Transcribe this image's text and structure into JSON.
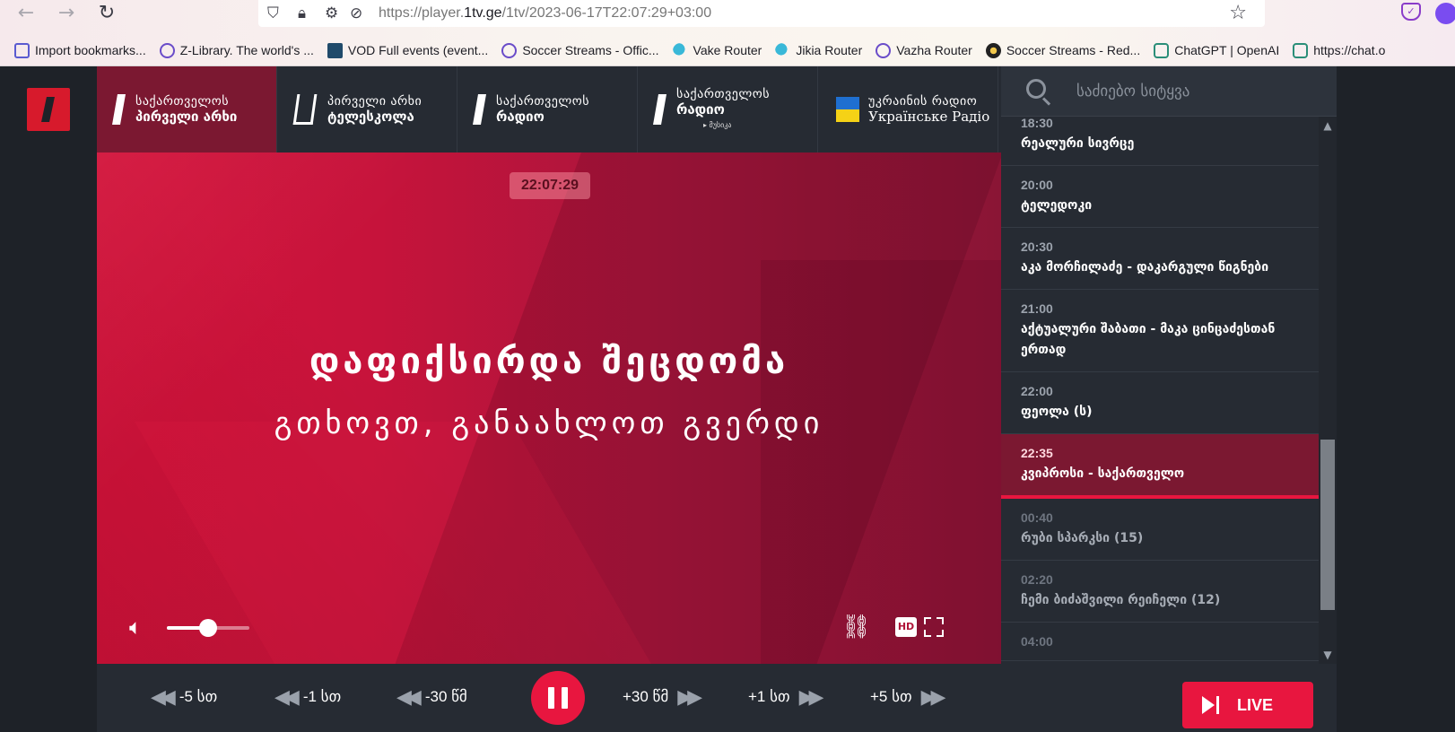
{
  "browser": {
    "back_icon": "←",
    "forward_icon": "→",
    "reload_icon": "↻",
    "url_prefix": "https://player.",
    "url_host": "1tv.ge",
    "url_path": "/1tv/2023-06-17T22:07:29+03:00",
    "bookmarks": [
      {
        "label": "Import bookmarks...",
        "icon": "import-icon"
      },
      {
        "label": "Z-Library. The world's ...",
        "icon": "globe-icon"
      },
      {
        "label": "VOD Full events (event...",
        "icon": "vod-icon"
      },
      {
        "label": "Soccer Streams - Offic...",
        "icon": "globe-icon"
      },
      {
        "label": "Vake Router",
        "icon": "router-icon"
      },
      {
        "label": "Jikia Router",
        "icon": "router-icon"
      },
      {
        "label": "Vazha Router",
        "icon": "globe-icon"
      },
      {
        "label": "Soccer Streams - Red...",
        "icon": "ball-icon"
      },
      {
        "label": "ChatGPT | OpenAI",
        "icon": "chatgpt-icon"
      },
      {
        "label": "https://chat.o",
        "icon": "chatgpt-icon"
      }
    ]
  },
  "channels": [
    {
      "line1": "საქართველოს",
      "line2": "პირველი არხი",
      "line3": "",
      "active": true
    },
    {
      "line1": "პირველი არხი",
      "line2": "ტელესკოლა",
      "line3": "",
      "active": false
    },
    {
      "line1": "საქართველოს",
      "line2": "რადიო",
      "line3": "",
      "active": false
    },
    {
      "line1": "საქართველოს",
      "line2": "რადიო",
      "line3": "▸ მუსიკა",
      "active": false
    },
    {
      "line1": "უკრაინის რადიო",
      "line2": "Українське Радіо",
      "line3": "",
      "active": false
    }
  ],
  "player": {
    "clock": "22:07:29",
    "error_title": "დაფიქსირდა შეცდომა",
    "error_subtitle": "გთხოვთ, განაახლოთ გვერდი",
    "volume_level": 0.5,
    "hd_label": "HD"
  },
  "schedule": {
    "search_placeholder": "საძიებო სიტყვა",
    "items": [
      {
        "time": "18:30",
        "title": "რეალური სივრცე",
        "state": "past"
      },
      {
        "time": "20:00",
        "title": "ტელედოკი",
        "state": "past"
      },
      {
        "time": "20:30",
        "title": "აკა მორჩილაძე - დაკარგული წიგნები",
        "state": "past"
      },
      {
        "time": "21:00",
        "title": "აქტუალური შაბათი - მაკა ცინცაძესთან ერთად",
        "state": "past"
      },
      {
        "time": "22:00",
        "title": "ფეოლა (ს)",
        "state": "past"
      },
      {
        "time": "22:35",
        "title": "კვიპროსი - საქართველო",
        "state": "current"
      },
      {
        "time": "00:40",
        "title": "რუბი სპარკსი (15)",
        "state": "future"
      },
      {
        "time": "02:20",
        "title": "ჩემი ბიძაშვილი რეიჩელი (12)",
        "state": "future"
      },
      {
        "time": "04:00",
        "title": "",
        "state": "future"
      }
    ]
  },
  "controls": {
    "back_5h": "-5 სთ",
    "back_1h": "-1 სთ",
    "back_30s": "-30 წმ",
    "fwd_30s": "+30 წმ",
    "fwd_1h": "+1 სთ",
    "fwd_5h": "+5 სთ",
    "live_label": "LIVE"
  },
  "colors": {
    "accent": "#e8163f",
    "active_tab": "#7b1831",
    "panel": "#262b33",
    "background": "#1e2228"
  }
}
